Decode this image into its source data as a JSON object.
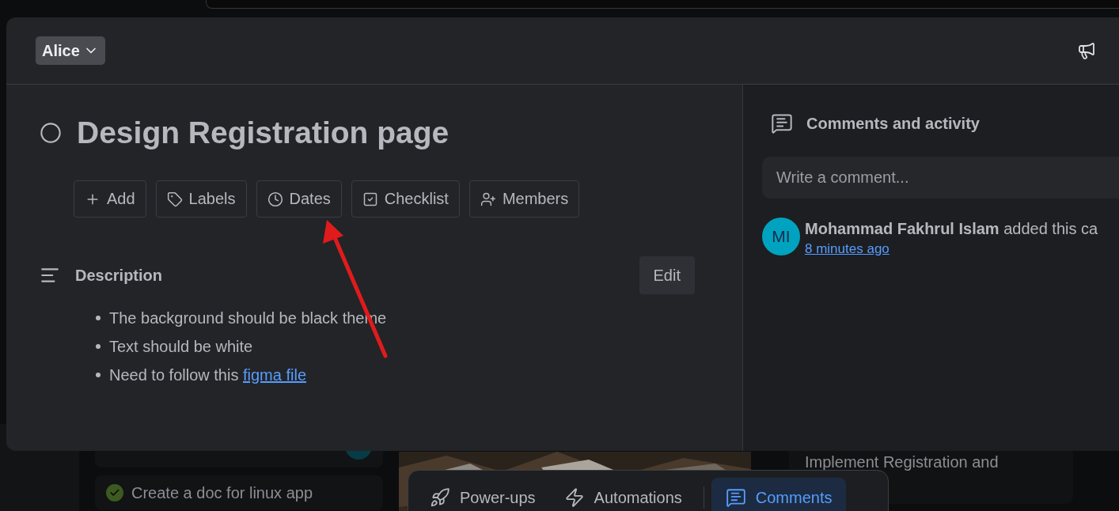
{
  "background_cards": [
    {
      "text": "Create a doc for linux app",
      "done": true
    },
    {
      "text": "Implement Registration and",
      "done": false
    }
  ],
  "header": {
    "member_menu": {
      "label": "Alice"
    }
  },
  "card": {
    "title": "Design Registration page",
    "completed": false,
    "actions": [
      {
        "label": "Add"
      },
      {
        "label": "Labels"
      },
      {
        "label": "Dates"
      },
      {
        "label": "Checklist"
      },
      {
        "label": "Members"
      }
    ],
    "description": {
      "heading": "Description",
      "edit_label": "Edit",
      "items": [
        {
          "text": "The background should be black theme"
        },
        {
          "text": "Text should be white"
        },
        {
          "text": "Need to follow this",
          "link": "figma file"
        }
      ]
    }
  },
  "activity": {
    "heading": "Comments and activity",
    "comment_placeholder": "Write a comment...",
    "entries": [
      {
        "avatar": "MI",
        "author": "Mohammad Fakhrul Islam",
        "action": "added this ca",
        "time": "8 minutes ago"
      }
    ]
  },
  "bottom_bar": [
    {
      "label": "Power-ups",
      "selected": false
    },
    {
      "label": "Automations",
      "selected": false
    },
    {
      "label": "Comments",
      "selected": true
    }
  ]
}
